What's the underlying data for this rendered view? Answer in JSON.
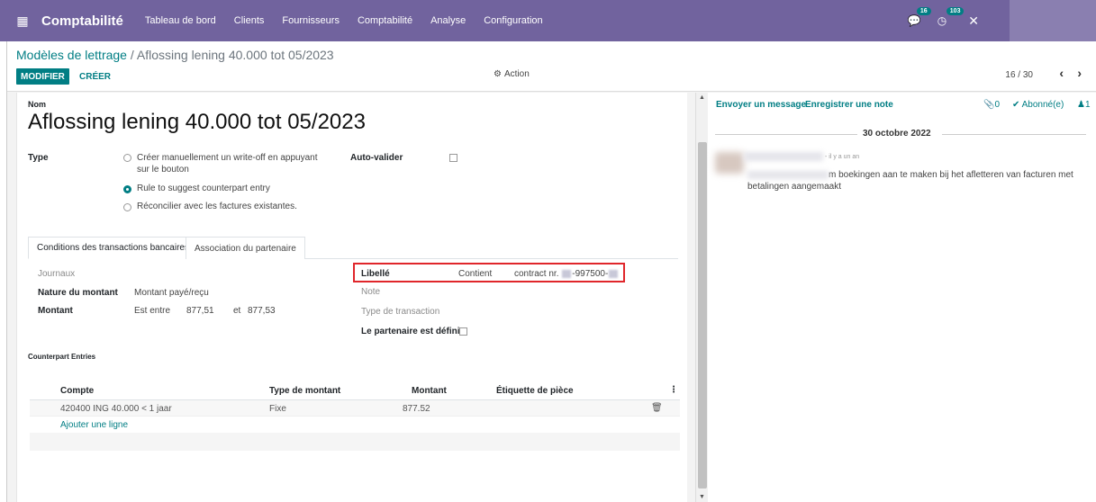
{
  "navbar": {
    "app_name": "Comptabilité",
    "menus": [
      "Tableau de bord",
      "Clients",
      "Fournisseurs",
      "Comptabilité",
      "Analyse",
      "Configuration"
    ],
    "messages_badge": "16",
    "activity_badge": "103"
  },
  "control": {
    "breadcrumb_parent": "Modèles de lettrage",
    "breadcrumb_sep": " / ",
    "breadcrumb_current": "Aflossing lening 40.000 tot 05/2023",
    "edit_label": "MODIFIER",
    "create_label": "CRÉER",
    "action_label": "Action",
    "pager": "16 / 30"
  },
  "form": {
    "name_label": "Nom",
    "name_value": "Aflossing lening 40.000 tot 05/2023",
    "type_label": "Type",
    "type_options": [
      "Créer manuellement un write-off en appuyant sur le bouton",
      "Rule to suggest counterpart entry",
      "Réconcilier avec les factures existantes."
    ],
    "type_selected_index": 1,
    "auto_validate_label": "Auto-valider",
    "auto_validate_checked": false,
    "tabs": [
      "Conditions des transactions bancaires",
      "Association du partenaire"
    ],
    "active_tab_index": 0,
    "journals_label": "Journaux",
    "amount_nature_label": "Nature du montant",
    "amount_nature_value": "Montant payé/reçu",
    "amount_label": "Montant",
    "amount_condition": "Est entre",
    "amount_min": "877,51",
    "amount_max_prefix": "et",
    "amount_max": "877,53",
    "label_label": "Libellé",
    "label_condition": "Contient",
    "label_value_prefix": "contract nr. ",
    "label_value_suffix": "-997500-",
    "note_label": "Note",
    "transaction_type_label": "Type de transaction",
    "partner_defined_label": "Le partenaire est défini",
    "partner_defined_checked": false,
    "counterpart_title": "Counterpart Entries",
    "table_headers": [
      "Compte",
      "Type de montant",
      "Montant",
      "Étiquette de pièce"
    ],
    "table_rows": [
      {
        "account": "420400 ING 40.000 < 1 jaar",
        "amount_type": "Fixe",
        "amount": "877.52",
        "label": ""
      }
    ],
    "add_line_label": "Ajouter une ligne"
  },
  "chatter": {
    "send_message": "Envoyer un message",
    "log_note": "Enregistrer une note",
    "attachments_count": "0",
    "follow_label": "Abonné(e)",
    "followers_count": "1",
    "date_separator": "30 octobre 2022",
    "message_time": "- il y a un an",
    "message_text": "m boekingen aan te maken bij het afletteren van facturen met betalingen aangemaakt"
  },
  "colors": {
    "navbar": "#71639e",
    "primary": "#017e84",
    "highlight": "#e0262b"
  }
}
